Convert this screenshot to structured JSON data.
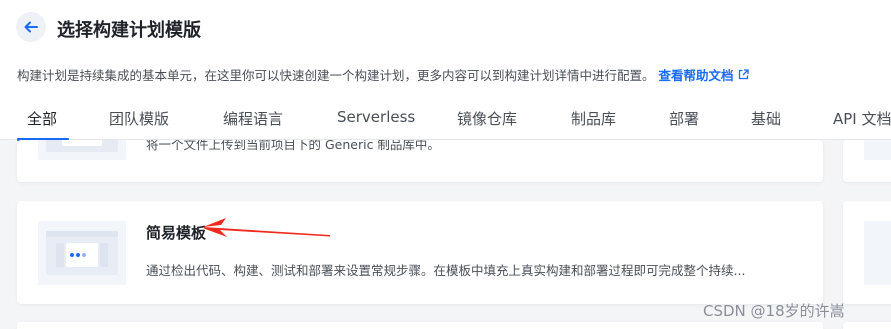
{
  "header": {
    "title": "选择构建计划模版",
    "back_icon": "arrow-left-icon"
  },
  "description": {
    "text": "构建计划是持续集成的基本单元，在这里你可以快速创建一个构建计划，更多内容可以到构建计划详情中进行配置。",
    "help_link": "查看帮助文档",
    "help_icon": "external-link-icon"
  },
  "tabs": [
    {
      "label": "全部",
      "active": true
    },
    {
      "label": "团队模版"
    },
    {
      "label": "编程语言"
    },
    {
      "label": "Serverless"
    },
    {
      "label": "镜像仓库"
    },
    {
      "label": "制品库"
    },
    {
      "label": "部署"
    },
    {
      "label": "基础"
    },
    {
      "label": "API 文档"
    }
  ],
  "cards": {
    "prev_card_desc": "将一个文件上传到当前项目下的 Generic 制品库中。",
    "simple": {
      "title": "简易模板",
      "desc": "通过检出代码、构建、测试和部署来设置常规步骤。在模板中填充上真实构建和部署过程即可完成整个持续..."
    }
  },
  "watermark": "CSDN @18岁的许嵩",
  "colors": {
    "accent": "#1a6cf5",
    "arrow": "#f02b1d",
    "background": "#f4f5f7"
  }
}
